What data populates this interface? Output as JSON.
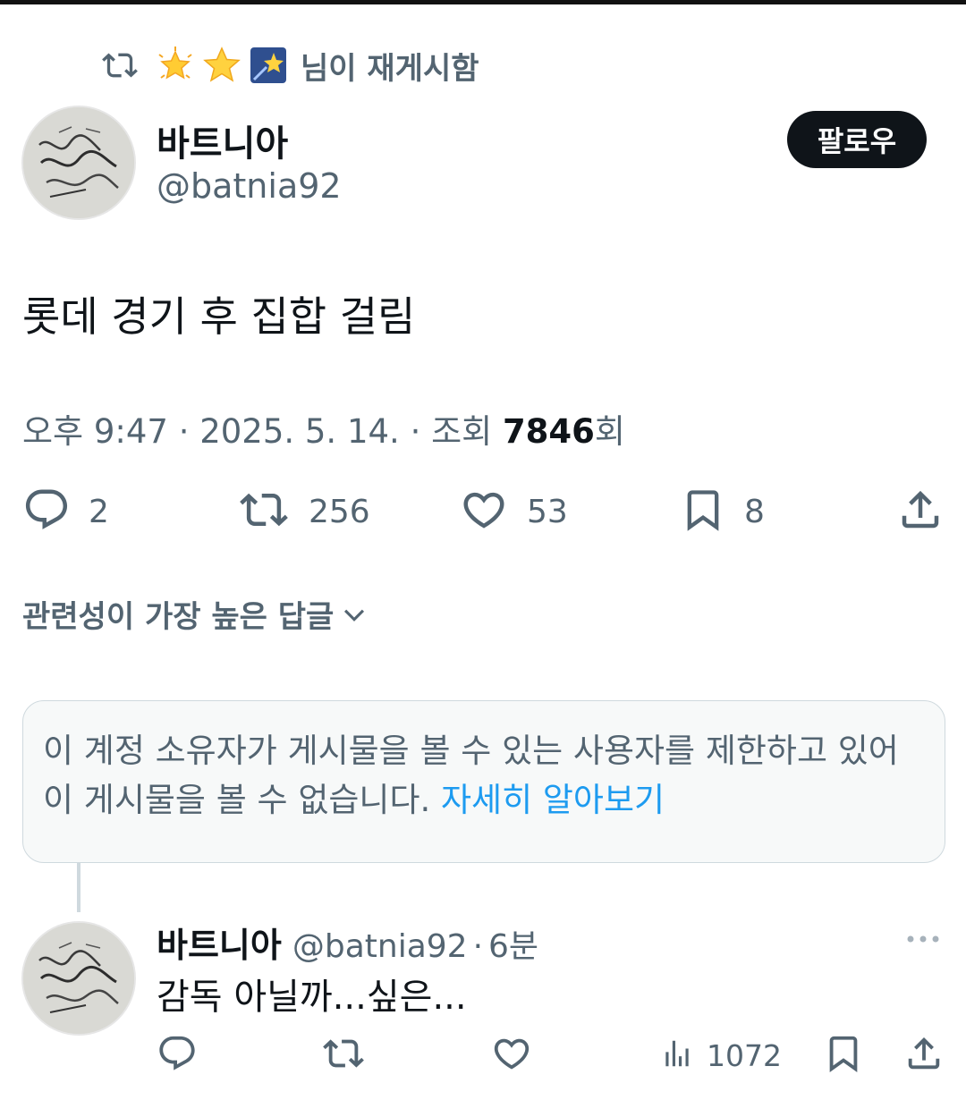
{
  "repost_banner": {
    "icon": "repost-icon",
    "emojis": [
      "glowing-star",
      "star",
      "shooting-star"
    ],
    "text": "님이 재게시함"
  },
  "tweet": {
    "author_name": "바트니아",
    "author_handle": "@batnia92",
    "follow_label": "팔로우",
    "text": "롯데 경기 후 집합 걸림",
    "meta_prefix": "오후 9:47 · 2025. 5. 14. · 조회 ",
    "views": "7846",
    "views_suffix": "회",
    "actions": {
      "replies": "2",
      "reposts": "256",
      "likes": "53",
      "bookmarks": "8"
    }
  },
  "replies_sort": {
    "label": "관련성이 가장 높은 답글"
  },
  "restricted_notice": {
    "text": "이 계정 소유자가 게시물을 볼 수 있는 사용자를 제한하고 있어 이 게시물을 볼 수 없습니다. ",
    "link": "자세히 알아보기"
  },
  "reply": {
    "author_name": "바트니아",
    "author_handle": "@batnia92",
    "time": "6분",
    "text": "감독 아닐까...싶은...",
    "views": "1072"
  },
  "colors": {
    "text_primary": "#0f1419",
    "text_secondary": "#536471",
    "link": "#1d9bf0",
    "follow_bg": "#0f1419"
  }
}
